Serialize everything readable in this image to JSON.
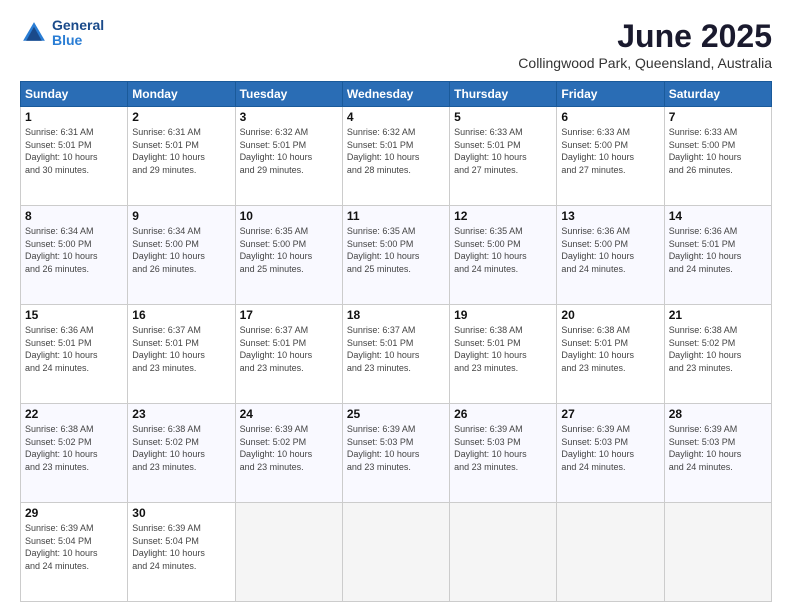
{
  "header": {
    "logo_line1": "General",
    "logo_line2": "Blue",
    "month": "June 2025",
    "location": "Collingwood Park, Queensland, Australia"
  },
  "weekdays": [
    "Sunday",
    "Monday",
    "Tuesday",
    "Wednesday",
    "Thursday",
    "Friday",
    "Saturday"
  ],
  "weeks": [
    [
      {
        "day": "1",
        "info": "Sunrise: 6:31 AM\nSunset: 5:01 PM\nDaylight: 10 hours\nand 30 minutes."
      },
      {
        "day": "2",
        "info": "Sunrise: 6:31 AM\nSunset: 5:01 PM\nDaylight: 10 hours\nand 29 minutes."
      },
      {
        "day": "3",
        "info": "Sunrise: 6:32 AM\nSunset: 5:01 PM\nDaylight: 10 hours\nand 29 minutes."
      },
      {
        "day": "4",
        "info": "Sunrise: 6:32 AM\nSunset: 5:01 PM\nDaylight: 10 hours\nand 28 minutes."
      },
      {
        "day": "5",
        "info": "Sunrise: 6:33 AM\nSunset: 5:01 PM\nDaylight: 10 hours\nand 27 minutes."
      },
      {
        "day": "6",
        "info": "Sunrise: 6:33 AM\nSunset: 5:00 PM\nDaylight: 10 hours\nand 27 minutes."
      },
      {
        "day": "7",
        "info": "Sunrise: 6:33 AM\nSunset: 5:00 PM\nDaylight: 10 hours\nand 26 minutes."
      }
    ],
    [
      {
        "day": "8",
        "info": "Sunrise: 6:34 AM\nSunset: 5:00 PM\nDaylight: 10 hours\nand 26 minutes."
      },
      {
        "day": "9",
        "info": "Sunrise: 6:34 AM\nSunset: 5:00 PM\nDaylight: 10 hours\nand 26 minutes."
      },
      {
        "day": "10",
        "info": "Sunrise: 6:35 AM\nSunset: 5:00 PM\nDaylight: 10 hours\nand 25 minutes."
      },
      {
        "day": "11",
        "info": "Sunrise: 6:35 AM\nSunset: 5:00 PM\nDaylight: 10 hours\nand 25 minutes."
      },
      {
        "day": "12",
        "info": "Sunrise: 6:35 AM\nSunset: 5:00 PM\nDaylight: 10 hours\nand 24 minutes."
      },
      {
        "day": "13",
        "info": "Sunrise: 6:36 AM\nSunset: 5:00 PM\nDaylight: 10 hours\nand 24 minutes."
      },
      {
        "day": "14",
        "info": "Sunrise: 6:36 AM\nSunset: 5:01 PM\nDaylight: 10 hours\nand 24 minutes."
      }
    ],
    [
      {
        "day": "15",
        "info": "Sunrise: 6:36 AM\nSunset: 5:01 PM\nDaylight: 10 hours\nand 24 minutes."
      },
      {
        "day": "16",
        "info": "Sunrise: 6:37 AM\nSunset: 5:01 PM\nDaylight: 10 hours\nand 23 minutes."
      },
      {
        "day": "17",
        "info": "Sunrise: 6:37 AM\nSunset: 5:01 PM\nDaylight: 10 hours\nand 23 minutes."
      },
      {
        "day": "18",
        "info": "Sunrise: 6:37 AM\nSunset: 5:01 PM\nDaylight: 10 hours\nand 23 minutes."
      },
      {
        "day": "19",
        "info": "Sunrise: 6:38 AM\nSunset: 5:01 PM\nDaylight: 10 hours\nand 23 minutes."
      },
      {
        "day": "20",
        "info": "Sunrise: 6:38 AM\nSunset: 5:01 PM\nDaylight: 10 hours\nand 23 minutes."
      },
      {
        "day": "21",
        "info": "Sunrise: 6:38 AM\nSunset: 5:02 PM\nDaylight: 10 hours\nand 23 minutes."
      }
    ],
    [
      {
        "day": "22",
        "info": "Sunrise: 6:38 AM\nSunset: 5:02 PM\nDaylight: 10 hours\nand 23 minutes."
      },
      {
        "day": "23",
        "info": "Sunrise: 6:38 AM\nSunset: 5:02 PM\nDaylight: 10 hours\nand 23 minutes."
      },
      {
        "day": "24",
        "info": "Sunrise: 6:39 AM\nSunset: 5:02 PM\nDaylight: 10 hours\nand 23 minutes."
      },
      {
        "day": "25",
        "info": "Sunrise: 6:39 AM\nSunset: 5:03 PM\nDaylight: 10 hours\nand 23 minutes."
      },
      {
        "day": "26",
        "info": "Sunrise: 6:39 AM\nSunset: 5:03 PM\nDaylight: 10 hours\nand 23 minutes."
      },
      {
        "day": "27",
        "info": "Sunrise: 6:39 AM\nSunset: 5:03 PM\nDaylight: 10 hours\nand 24 minutes."
      },
      {
        "day": "28",
        "info": "Sunrise: 6:39 AM\nSunset: 5:03 PM\nDaylight: 10 hours\nand 24 minutes."
      }
    ],
    [
      {
        "day": "29",
        "info": "Sunrise: 6:39 AM\nSunset: 5:04 PM\nDaylight: 10 hours\nand 24 minutes."
      },
      {
        "day": "30",
        "info": "Sunrise: 6:39 AM\nSunset: 5:04 PM\nDaylight: 10 hours\nand 24 minutes."
      },
      {
        "day": "",
        "info": ""
      },
      {
        "day": "",
        "info": ""
      },
      {
        "day": "",
        "info": ""
      },
      {
        "day": "",
        "info": ""
      },
      {
        "day": "",
        "info": ""
      }
    ]
  ]
}
